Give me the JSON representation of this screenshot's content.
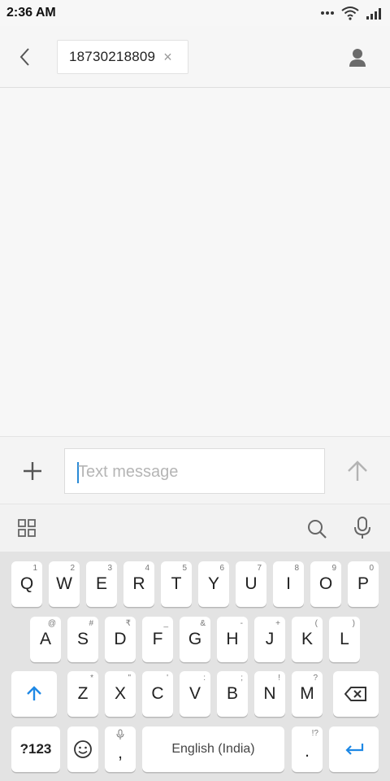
{
  "status_bar": {
    "time": "2:36 AM",
    "icons": [
      "more-dots-icon",
      "wifi-icon",
      "signal-icon"
    ]
  },
  "header": {
    "recipient": "18730218809",
    "remove_chip": "×",
    "icons": [
      "back-arrow-icon",
      "contact-person-icon"
    ]
  },
  "composer": {
    "placeholder": "Text message",
    "value": "",
    "icons": [
      "plus-icon",
      "send-arrow-icon"
    ]
  },
  "suggestion_bar": {
    "icons": [
      "apps-grid-icon",
      "search-icon",
      "mic-icon"
    ]
  },
  "keyboard": {
    "row1": [
      {
        "label": "Q",
        "hint": "1"
      },
      {
        "label": "W",
        "hint": "2"
      },
      {
        "label": "E",
        "hint": "3"
      },
      {
        "label": "R",
        "hint": "4"
      },
      {
        "label": "T",
        "hint": "5"
      },
      {
        "label": "Y",
        "hint": "6"
      },
      {
        "label": "U",
        "hint": "7"
      },
      {
        "label": "I",
        "hint": "8"
      },
      {
        "label": "O",
        "hint": "9"
      },
      {
        "label": "P",
        "hint": "0"
      }
    ],
    "row2": [
      {
        "label": "A",
        "hint": "@"
      },
      {
        "label": "S",
        "hint": "#"
      },
      {
        "label": "D",
        "hint": "₹"
      },
      {
        "label": "F",
        "hint": "_"
      },
      {
        "label": "G",
        "hint": "&"
      },
      {
        "label": "H",
        "hint": "-"
      },
      {
        "label": "J",
        "hint": "+"
      },
      {
        "label": "K",
        "hint": "("
      },
      {
        "label": "L",
        "hint": ")"
      }
    ],
    "row3": [
      {
        "label": "Z",
        "hint": "*"
      },
      {
        "label": "X",
        "hint": "\""
      },
      {
        "label": "C",
        "hint": "'"
      },
      {
        "label": "V",
        "hint": ":"
      },
      {
        "label": "B",
        "hint": ";"
      },
      {
        "label": "N",
        "hint": "!"
      },
      {
        "label": "M",
        "hint": "?"
      }
    ],
    "symbols_label": "?123",
    "comma": ",",
    "space_label": "English (India)",
    "period": ".",
    "period_hint": "!?",
    "accent_color": "#1e88e5"
  }
}
